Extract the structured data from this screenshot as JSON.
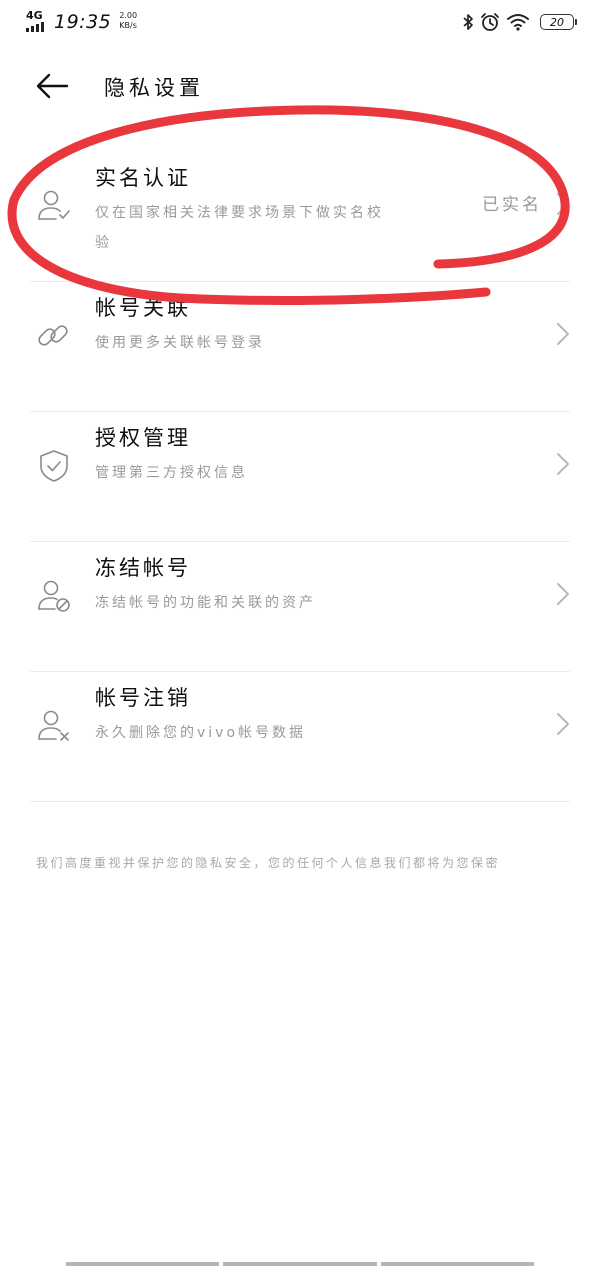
{
  "status_bar": {
    "network": "4G",
    "time": "19:35",
    "speed_value": "2.00",
    "speed_unit": "KB/s",
    "battery": "20"
  },
  "header": {
    "title": "隐私设置"
  },
  "items": [
    {
      "title": "实名认证",
      "description": "仅在国家相关法律要求场景下做实名校验",
      "value": "已实名",
      "icon": "user-check-icon"
    },
    {
      "title": "帐号关联",
      "description": "使用更多关联帐号登录",
      "value": "",
      "icon": "link-icon"
    },
    {
      "title": "授权管理",
      "description": "管理第三方授权信息",
      "value": "",
      "icon": "shield-check-icon"
    },
    {
      "title": "冻结帐号",
      "description": "冻结帐号的功能和关联的资产",
      "value": "",
      "icon": "user-block-icon"
    },
    {
      "title": "帐号注销",
      "description": "永久删除您的vivo帐号数据",
      "value": "",
      "icon": "user-remove-icon"
    }
  ],
  "footer": {
    "note": "我们高度重视并保护您的隐私安全，您的任何个人信息我们都将为您保密"
  },
  "colors": {
    "annotation": "#e8383d",
    "secondary_text": "#9a9a9a",
    "divider": "#ececec"
  }
}
